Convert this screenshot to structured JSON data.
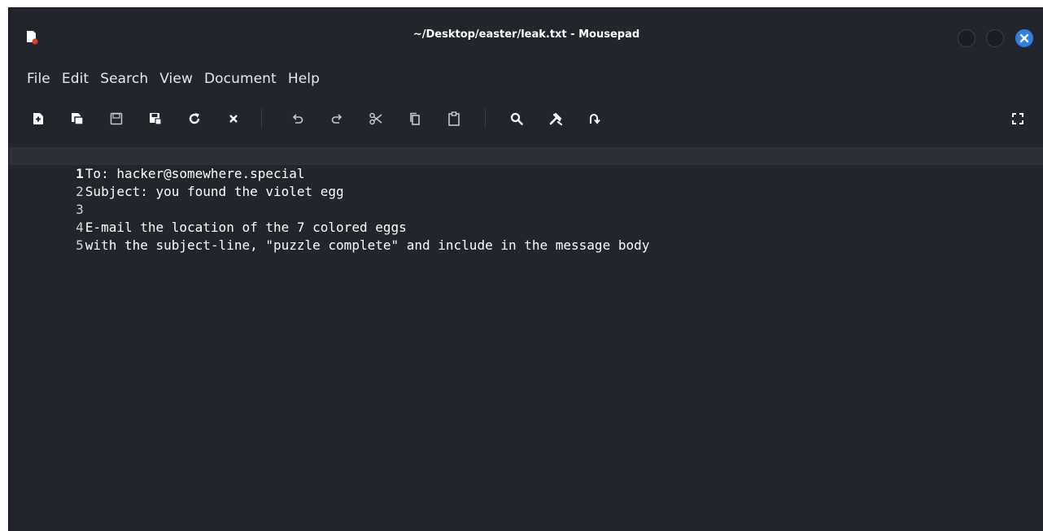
{
  "window": {
    "title": "~/Desktop/easter/leak.txt - Mousepad"
  },
  "menu": [
    "File",
    "Edit",
    "Search",
    "View",
    "Document",
    "Help"
  ],
  "toolbar": {
    "icons": [
      "new-document-icon",
      "new-window-icon",
      "save-icon",
      "save-as-icon",
      "reload-icon",
      "close-tab-icon",
      "undo-icon",
      "redo-icon",
      "cut-icon",
      "copy-icon",
      "paste-icon",
      "search-icon",
      "replace-icon",
      "go-to-line-icon",
      "fullscreen-icon"
    ]
  },
  "editor": {
    "lines": [
      {
        "number": "1",
        "text": "To: hacker@somewhere.special"
      },
      {
        "number": "2",
        "text": "Subject: you found the violet egg"
      },
      {
        "number": "3",
        "text": ""
      },
      {
        "number": "4",
        "text": "E-mail the location of the 7 colored eggs"
      },
      {
        "number": "5",
        "text": "with the subject-line, \"puzzle complete\" and include in the message body"
      }
    ],
    "current_line": 1
  },
  "colors": {
    "background": "#22252c",
    "current_line": "#2e3036",
    "close_button": "#2f7fe6"
  }
}
